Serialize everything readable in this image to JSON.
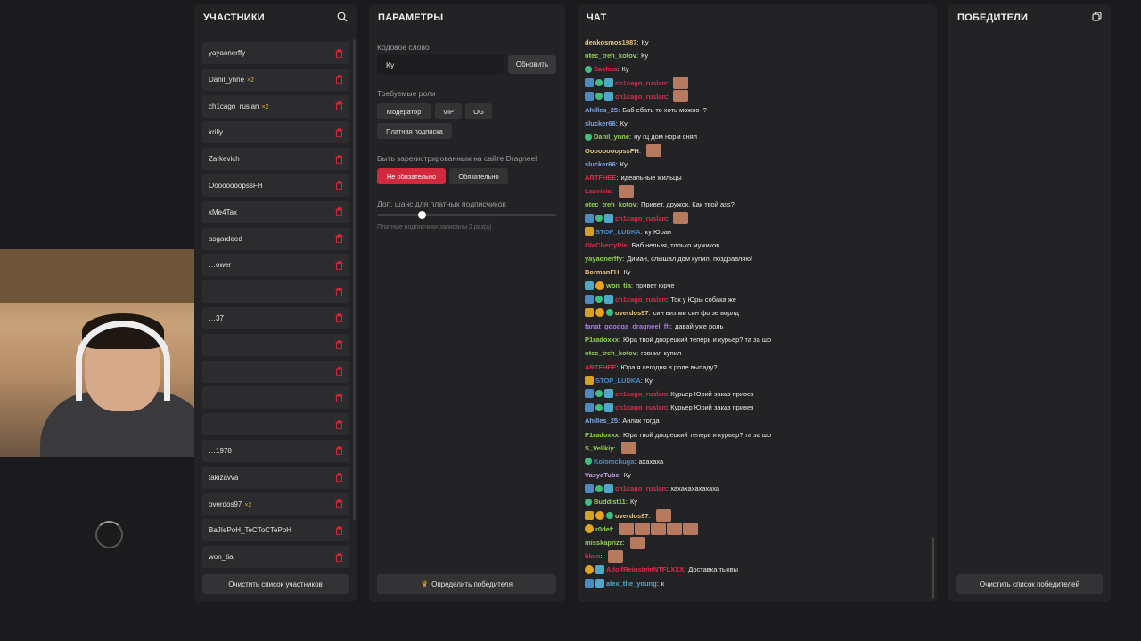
{
  "participants": {
    "title": "УЧАСТНИКИ",
    "items": [
      {
        "name": "yayaonerffy",
        "mult": ""
      },
      {
        "name": "Danil_ynne",
        "mult": "×2"
      },
      {
        "name": "ch1cago_ruslan",
        "mult": "×2"
      },
      {
        "name": "kriliy",
        "mult": ""
      },
      {
        "name": "Zarkevich",
        "mult": ""
      },
      {
        "name": "OooooooopssFH",
        "mult": ""
      },
      {
        "name": "xMe4Tax",
        "mult": ""
      },
      {
        "name": "asgardeed",
        "mult": ""
      },
      {
        "name": "…ower",
        "mult": ""
      },
      {
        "name": "",
        "mult": ""
      },
      {
        "name": "…37",
        "mult": ""
      },
      {
        "name": "",
        "mult": ""
      },
      {
        "name": "",
        "mult": ""
      },
      {
        "name": "",
        "mult": ""
      },
      {
        "name": "",
        "mult": ""
      },
      {
        "name": "…1978",
        "mult": ""
      },
      {
        "name": "takizavva",
        "mult": ""
      },
      {
        "name": "overdos97",
        "mult": "×2"
      },
      {
        "name": "BaJIePoH_TeCToCTePoH",
        "mult": ""
      },
      {
        "name": "won_tia",
        "mult": ""
      }
    ],
    "clear_label": "Очистить список участников"
  },
  "params": {
    "title": "ПАРАМЕТРЫ",
    "code_label": "Кодовое слово",
    "code_value": "Ку",
    "update_label": "Обновить",
    "roles_label": "Требуемые роли",
    "roles": [
      "Модератор",
      "VIP",
      "OG",
      "Платная подписка"
    ],
    "reg_label": "Быть зарегистрированным на сайте Dragneel",
    "reg_options": [
      "Не обязательно",
      "Обязательно"
    ],
    "bonus_label": "Доп. шанс для платных подписчиков",
    "bonus_value": 0.25,
    "bonus_note": "Платные подписчики записаны 2 раз(а)",
    "winner_label": "Определить победителя"
  },
  "chat": {
    "title": "ЧАТ",
    "messages": [
      {
        "badges": [],
        "user": "denkosmos1987",
        "color": "#e6c77a",
        "text": "Ку",
        "emotes": 0
      },
      {
        "badges": [],
        "user": "otec_treh_kotov",
        "color": "#8fd14f",
        "text": "Ку",
        "emotes": 0
      },
      {
        "badges": [
          "green"
        ],
        "user": "Sashxa",
        "color": "#e0284a",
        "text": "Ку",
        "emotes": 0
      },
      {
        "badges": [
          "blue",
          "green",
          "teal"
        ],
        "user": "ch1cago_ruslan",
        "color": "#e0284a",
        "text": "",
        "emotes": 1
      },
      {
        "badges": [
          "blue",
          "green",
          "teal"
        ],
        "user": "ch1cago_ruslan",
        "color": "#e0284a",
        "text": "",
        "emotes": 1
      },
      {
        "badges": [],
        "user": "Ahilles_25",
        "color": "#7fa8e8",
        "text": "Баб ебать то хоть можно !?",
        "emotes": 0
      },
      {
        "badges": [],
        "user": "slucker66",
        "color": "#7fa8e8",
        "text": "Ку",
        "emotes": 0
      },
      {
        "badges": [
          "green"
        ],
        "user": "Danil_ynne",
        "color": "#8fd14f",
        "text": "ну гц дом норм снял",
        "emotes": 0
      },
      {
        "badges": [],
        "user": "OooooooopssFH",
        "color": "#e6c77a",
        "text": "",
        "emotes": 1
      },
      {
        "badges": [],
        "user": "slucker66",
        "color": "#7fa8e8",
        "text": "Ку",
        "emotes": 0
      },
      {
        "badges": [],
        "user": "ARTFHEE",
        "color": "#e0284a",
        "text": "идеальные жильцы",
        "emotes": 0
      },
      {
        "badges": [],
        "user": "Laavixia",
        "color": "#e0284a",
        "text": "",
        "emotes": 1
      },
      {
        "badges": [],
        "user": "otec_treh_kotov",
        "color": "#8fd14f",
        "text": "Привет, дружок. Как твой ass?",
        "emotes": 0
      },
      {
        "badges": [
          "blue",
          "green",
          "teal"
        ],
        "user": "ch1cago_ruslan",
        "color": "#e0284a",
        "text": "",
        "emotes": 1
      },
      {
        "badges": [
          "gold"
        ],
        "user": "STOP_LUDKA",
        "color": "#4a8ac8",
        "text": "ку Юран",
        "emotes": 0
      },
      {
        "badges": [],
        "user": "OleCherryPie",
        "color": "#e0284a",
        "text": "Баб нельзя, только мужиков",
        "emotes": 0
      },
      {
        "badges": [],
        "user": "yayaonerffy",
        "color": "#8fd14f",
        "text": "Диман, слышал дом купил, поздравляю!",
        "emotes": 0
      },
      {
        "badges": [],
        "user": "BormanFH",
        "color": "#e6c77a",
        "text": "Ку",
        "emotes": 0
      },
      {
        "badges": [
          "teal",
          "coin"
        ],
        "user": "won_tia",
        "color": "#8fd14f",
        "text": "привет юрче",
        "emotes": 0
      },
      {
        "badges": [
          "blue",
          "green",
          "teal"
        ],
        "user": "ch1cago_ruslan",
        "color": "#e0284a",
        "text": "Ток у Юры собака же",
        "emotes": 0
      },
      {
        "badges": [
          "gold",
          "coin",
          "green"
        ],
        "user": "overdos97",
        "color": "#e6c77a",
        "text": "син виз ми син фо зе ворлд",
        "emotes": 0
      },
      {
        "badges": [],
        "user": "fanat_goodqa_dragneel_fh",
        "color": "#a878e8",
        "text": "давай уже роль",
        "emotes": 0
      },
      {
        "badges": [],
        "user": "P1radoxxx",
        "color": "#8fd14f",
        "text": "Юра твой дворецкий теперь и курьер? та за шо",
        "emotes": 0
      },
      {
        "badges": [],
        "user": "otec_treh_kotov",
        "color": "#8fd14f",
        "text": "говнил купил",
        "emotes": 0
      },
      {
        "badges": [],
        "user": "ARTFHEE",
        "color": "#e0284a",
        "text": "Юра я сегодня в роле выпаду?",
        "emotes": 0
      },
      {
        "badges": [
          "gold"
        ],
        "user": "STOP_LUDKA",
        "color": "#4a8ac8",
        "text": "Ку",
        "emotes": 0
      },
      {
        "badges": [
          "blue",
          "green",
          "teal"
        ],
        "user": "ch1cago_ruslan",
        "color": "#e0284a",
        "text": "Курьер Юрий заказ привез",
        "emotes": 0
      },
      {
        "badges": [
          "blue",
          "green",
          "teal"
        ],
        "user": "ch1cago_ruslan",
        "color": "#e0284a",
        "text": "Курьер Юрий заказ привез",
        "emotes": 0
      },
      {
        "badges": [],
        "user": "Ahilles_25",
        "color": "#7fa8e8",
        "text": "Анлак тогда",
        "emotes": 0
      },
      {
        "badges": [],
        "user": "P1radoxxx",
        "color": "#8fd14f",
        "text": "Юра твой дворецкий теперь и курьер? та за шо",
        "emotes": 0
      },
      {
        "badges": [],
        "user": "S_Velikiy",
        "color": "#8fd14f",
        "text": "",
        "emotes": 1
      },
      {
        "badges": [
          "green"
        ],
        "user": "Kolomchuga",
        "color": "#4a8ac8",
        "text": "ахахаха",
        "emotes": 0
      },
      {
        "badges": [],
        "user": "VasyaTube",
        "color": "#c8a0e8",
        "text": "Ку",
        "emotes": 0
      },
      {
        "badges": [
          "blue",
          "green",
          "teal"
        ],
        "user": "ch1cago_ruslan",
        "color": "#e0284a",
        "text": "хахахахахахаха",
        "emotes": 0
      },
      {
        "badges": [
          "green"
        ],
        "user": "Buddist11",
        "color": "#8fd14f",
        "text": "Ку",
        "emotes": 0
      },
      {
        "badges": [
          "gold",
          "coin",
          "green"
        ],
        "user": "overdos97",
        "color": "#e6c77a",
        "text": "",
        "emotes": 1
      },
      {
        "badges": [
          "coin"
        ],
        "user": "r0def",
        "color": "#8fd14f",
        "text": "",
        "emotes": 5
      },
      {
        "badges": [],
        "user": "misskaprizz",
        "color": "#8fd14f",
        "text": "",
        "emotes": 1
      },
      {
        "badges": [],
        "user": "blam",
        "color": "#e0284a",
        "text": "",
        "emotes": 1
      },
      {
        "badges": [
          "coin",
          "teal"
        ],
        "user": "AdolfReinsteinNTFLXXX",
        "color": "#e0284a",
        "text": "Доставка тыквы",
        "emotes": 0
      },
      {
        "badges": [
          "blue",
          "teal"
        ],
        "user": "alex_the_young",
        "color": "#4fa8c8",
        "text": "к",
        "emotes": 0
      }
    ]
  },
  "winners": {
    "title": "ПОБЕДИТЕЛИ",
    "clear_label": "Очистить список победителей"
  },
  "icons": {
    "search": "search-icon",
    "trash": "trash-icon",
    "copy": "copy-icon",
    "crown": "crown-icon"
  },
  "colors": {
    "accent": "#d2283b",
    "panel": "#232325",
    "bg": "#1b1b1d"
  }
}
